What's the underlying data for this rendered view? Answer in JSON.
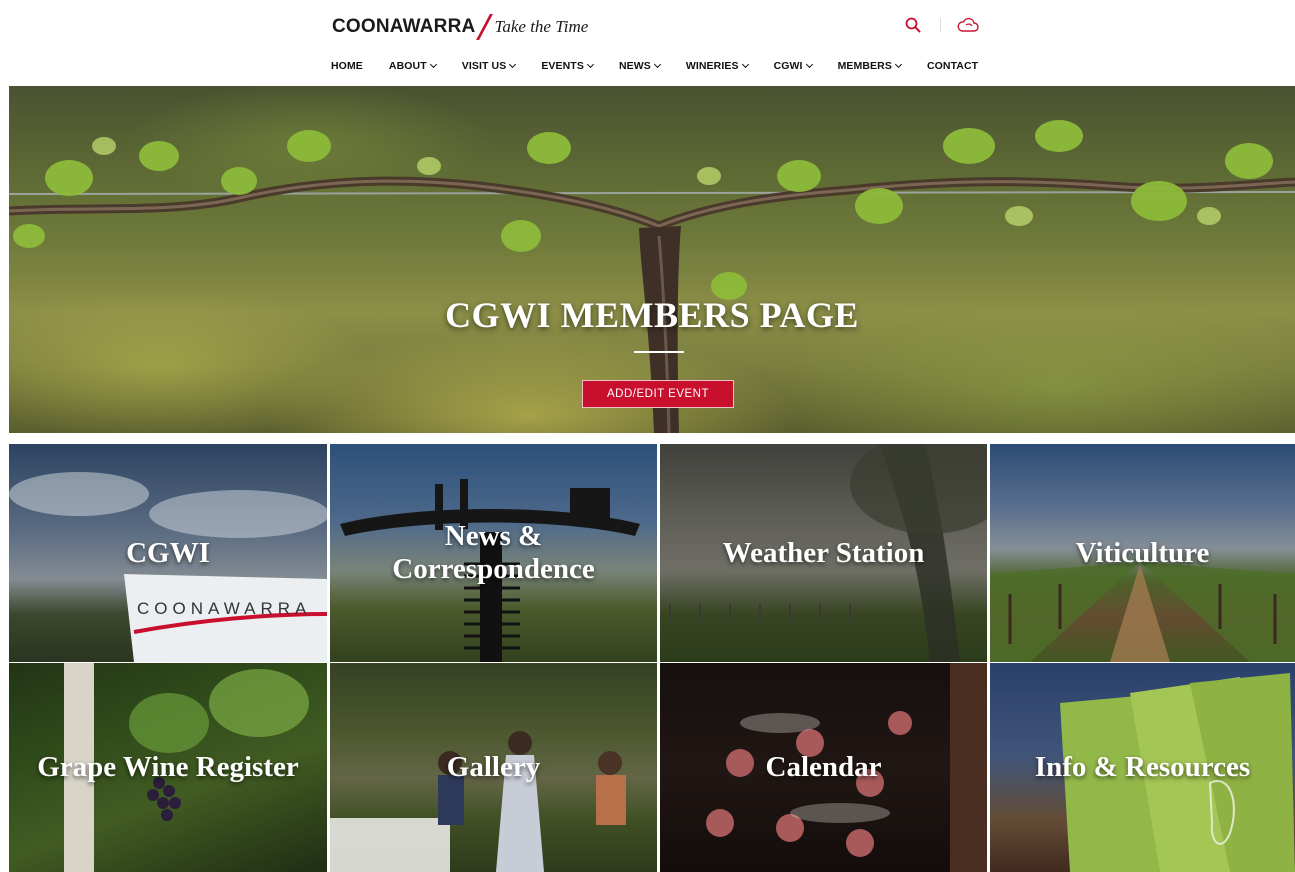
{
  "header": {
    "logo_word": "COONAWARRA",
    "logo_tagline": "Take the Time",
    "brand_color": "#c8102e",
    "icons": [
      "search-icon",
      "cloud-icon"
    ]
  },
  "nav": {
    "items": [
      {
        "label": "HOME",
        "dropdown": false
      },
      {
        "label": "ABOUT",
        "dropdown": true
      },
      {
        "label": "VISIT US",
        "dropdown": true
      },
      {
        "label": "EVENTS",
        "dropdown": true
      },
      {
        "label": "NEWS",
        "dropdown": true
      },
      {
        "label": "WINERIES",
        "dropdown": true
      },
      {
        "label": "CGWI",
        "dropdown": true
      },
      {
        "label": "MEMBERS",
        "dropdown": true
      },
      {
        "label": "CONTACT",
        "dropdown": false
      }
    ]
  },
  "hero": {
    "title": "CGWI MEMBERS PAGE",
    "button_label": "ADD/EDIT EVENT"
  },
  "tiles": [
    {
      "label": "CGWI"
    },
    {
      "label": "News & Correspondence"
    },
    {
      "label": "Weather Station"
    },
    {
      "label": "Viticulture"
    },
    {
      "label": "Grape Wine Register"
    },
    {
      "label": "Gallery"
    },
    {
      "label": "Calendar"
    },
    {
      "label": "Info & Resources"
    }
  ],
  "sign_text": "COONAWARRA"
}
